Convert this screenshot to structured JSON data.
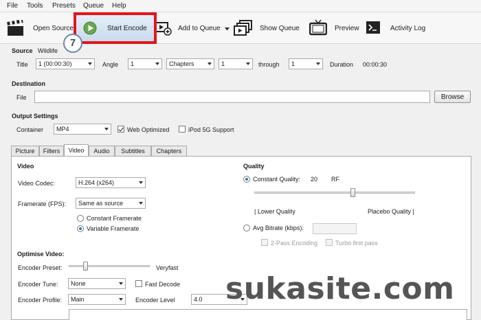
{
  "menu": [
    "File",
    "Tools",
    "Presets",
    "Queue",
    "Help"
  ],
  "toolbar": {
    "open_source": "Open Source",
    "start_encode": "Start Encode",
    "add_to_queue": "Add to Queue",
    "show_queue": "Show Queue",
    "preview": "Preview",
    "activity_log": "Activity Log"
  },
  "annotation": {
    "step": "7",
    "highlight_color": "#e3151b"
  },
  "source": {
    "label": "Source",
    "name": "Wildlife",
    "title_label": "Title",
    "title_value": "1 (00:00:30)",
    "angle_label": "Angle",
    "angle_value": "1",
    "range_type": "Chapters",
    "range_start": "1",
    "through_label": "through",
    "range_end": "1",
    "duration_label": "Duration",
    "duration_value": "00:00:30"
  },
  "destination": {
    "label": "Destination",
    "file_label": "File",
    "file_value": "",
    "browse": "Browse"
  },
  "output": {
    "label": "Output Settings",
    "container_label": "Container",
    "container_value": "MP4",
    "web_optimized": "Web Optimized",
    "ipod": "iPod 5G Support"
  },
  "tabs": [
    "Picture",
    "Filters",
    "Video",
    "Audio",
    "Subtitles",
    "Chapters"
  ],
  "active_tab": "Video",
  "video": {
    "section": "Video",
    "codec_label": "Video Codec:",
    "codec_value": "H.264 (x264)",
    "framerate_label": "Framerate (FPS):",
    "framerate_value": "Same as source",
    "constant_framerate": "Constant Framerate",
    "variable_framerate": "Variable Framerate"
  },
  "quality": {
    "section": "Quality",
    "constant_quality": "Constant Quality:",
    "cq_value": "20",
    "rf": "RF",
    "lower": "| Lower Quality",
    "placebo": "Placebo Quality |",
    "avg_bitrate": "Avg Bitrate (kbps):",
    "two_pass": "2-Pass Encoding",
    "turbo": "Turbo first pass"
  },
  "optimise": {
    "section": "Optimise Video:",
    "preset_label": "Encoder Preset:",
    "preset_value": "Veryfast",
    "tune_label": "Encoder Tune:",
    "tune_value": "None",
    "fast_decode": "Fast Decode",
    "profile_label": "Encoder Profile:",
    "profile_value": "Main",
    "level_label": "Encoder Level",
    "level_value": "4.0"
  },
  "watermark": "sukasite.com"
}
